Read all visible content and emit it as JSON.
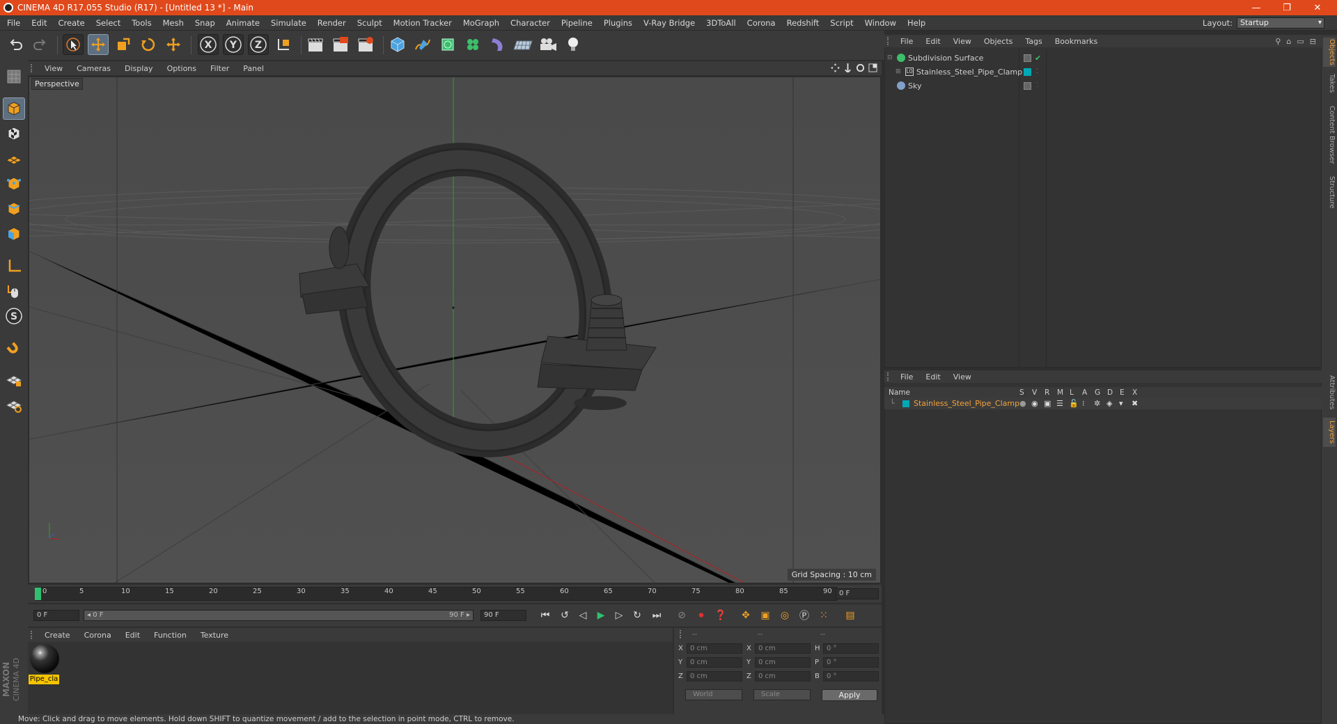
{
  "window": {
    "title": "CINEMA 4D R17.055 Studio (R17) - [Untitled 13 *] - Main",
    "controls": [
      "—",
      "❐",
      "✕"
    ]
  },
  "menubar": {
    "items": [
      "File",
      "Edit",
      "Create",
      "Select",
      "Tools",
      "Mesh",
      "Snap",
      "Animate",
      "Simulate",
      "Render",
      "Sculpt",
      "Motion Tracker",
      "MoGraph",
      "Character",
      "Pipeline",
      "Plugins",
      "V-Ray Bridge",
      "3DToAll",
      "Corona",
      "Redshift",
      "Script",
      "Window",
      "Help"
    ],
    "layout_label": "Layout:",
    "layout_value": "Startup"
  },
  "viewport": {
    "menu": [
      "View",
      "Cameras",
      "Display",
      "Options",
      "Filter",
      "Panel"
    ],
    "label": "Perspective",
    "grid_spacing": "Grid Spacing : 10 cm"
  },
  "timeline": {
    "ticks": [
      "0",
      "5",
      "10",
      "15",
      "20",
      "25",
      "30",
      "35",
      "40",
      "45",
      "50",
      "55",
      "60",
      "65",
      "70",
      "75",
      "80",
      "85",
      "90"
    ],
    "current_frame": "0 F",
    "start_field": "0 F",
    "range_start": "◂ 0 F",
    "range_end": "90 F ▸",
    "end_field": "90 F"
  },
  "material_manager": {
    "menu": [
      "Create",
      "Corona",
      "Edit",
      "Function",
      "Texture"
    ],
    "material_name": "Pipe_cla"
  },
  "coordinates": {
    "headers": [
      "--",
      "--",
      "--"
    ],
    "rows": [
      {
        "a": "X",
        "av": "0 cm",
        "b": "X",
        "bv": "0 cm",
        "c": "H",
        "cv": "0 °"
      },
      {
        "a": "Y",
        "av": "0 cm",
        "b": "Y",
        "bv": "0 cm",
        "c": "P",
        "cv": "0 °"
      },
      {
        "a": "Z",
        "av": "0 cm",
        "b": "Z",
        "bv": "0 cm",
        "c": "B",
        "cv": "0 °"
      }
    ],
    "mode1": "World",
    "mode2": "Scale",
    "apply": "Apply"
  },
  "status": "Move: Click and drag to move elements. Hold down SHIFT to quantize movement / add to the selection in point mode, CTRL to remove.",
  "object_manager": {
    "menu": [
      "File",
      "Edit",
      "View",
      "Objects",
      "Tags",
      "Bookmarks"
    ],
    "objects": [
      {
        "name": "Subdivision Surface"
      },
      {
        "name": "Stainless_Steel_Pipe_Clamp"
      },
      {
        "name": "Sky"
      }
    ]
  },
  "layer_manager": {
    "menu": [
      "File",
      "Edit",
      "View"
    ],
    "columns": [
      "Name",
      "S",
      "V",
      "R",
      "M",
      "L",
      "A",
      "G",
      "D",
      "E",
      "X"
    ],
    "layer_name": "Stainless_Steel_Pipe_Clamp"
  },
  "side_tabs": [
    "Objects",
    "Takes",
    "Content Browser",
    "Structure",
    "Attributes",
    "Layers"
  ],
  "brand": "MAXON CINEMA 4D",
  "colors": {
    "title_bar": "#e0491b",
    "accent": "#f2a23a",
    "layer_color": "#00a8b5",
    "selection": "#5e6f80"
  }
}
